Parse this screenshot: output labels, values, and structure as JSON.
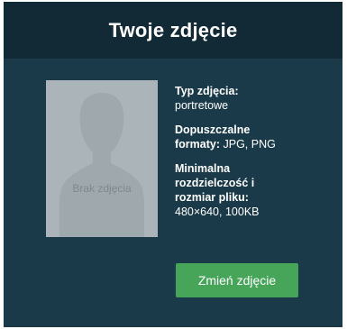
{
  "header": {
    "title": "Twoje zdjęcie"
  },
  "photo": {
    "placeholder_text": "Brak zdjęcia",
    "icon": "person-silhouette-icon"
  },
  "info": {
    "type_label": "Typ zdjęcia:",
    "type_value": "portretowe",
    "formats_label_line1": "Dopuszczalne",
    "formats_label_line2": "formaty",
    "formats_colon": ":",
    "formats_value": " JPG, PNG",
    "min_label_line1": "Minimalna",
    "min_label_line2": "rozdzielczość i",
    "min_label_line3": "rozmiar pliku:",
    "min_value": "480×640, 100KB"
  },
  "actions": {
    "change_photo_label": "Zmień zdjęcie"
  },
  "colors": {
    "card_background": "#1b3a49",
    "header_background": "#112a35",
    "button_green": "#47a55a",
    "placeholder_background": "#abb4b8"
  }
}
